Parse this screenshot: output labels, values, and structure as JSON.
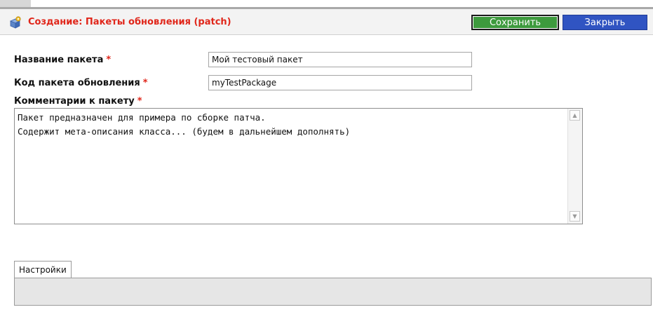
{
  "header": {
    "title": "Создание: Пакеты обновления (patch)",
    "icon": "package-gear-icon",
    "save_label": "Сохранить",
    "close_label": "Закрыть"
  },
  "form": {
    "package_name": {
      "label": "Название пакета",
      "required_mark": "*",
      "value": "Мой тестовый пакет"
    },
    "package_code": {
      "label": "Код пакета обновления",
      "required_mark": "*",
      "value": "myTestPackage"
    },
    "comments": {
      "label": "Комментарии к пакету",
      "required_mark": "*",
      "value": "Пакет предназначен для примера по сборке патча.\nСодержит мета-описания класса... (будем в дальнейшем дополнять)"
    }
  },
  "tabs": [
    {
      "label": "Настройки"
    }
  ],
  "colors": {
    "title_red": "#e0261a",
    "save_green": "#3d9a3d",
    "close_blue": "#3054c2"
  }
}
